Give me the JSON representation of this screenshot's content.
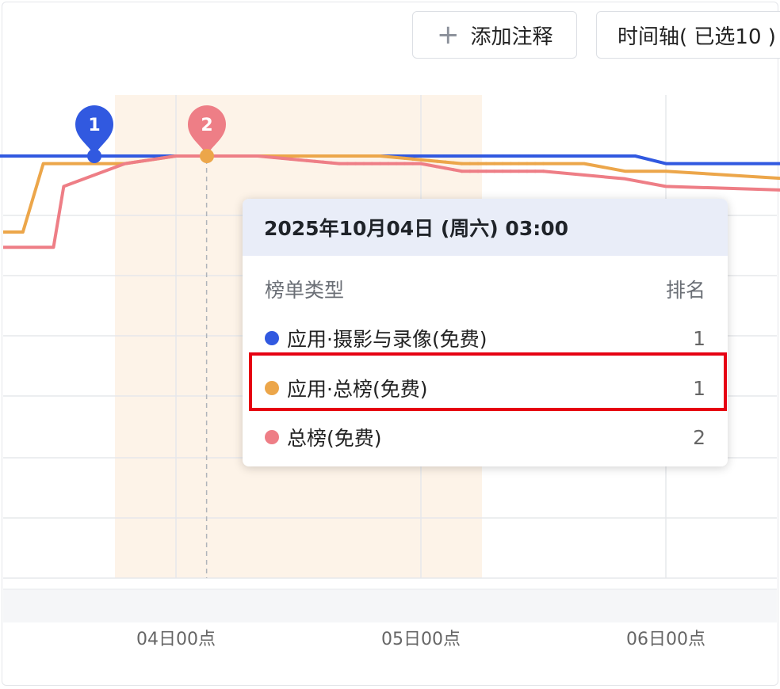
{
  "toolbar": {
    "add_note_label": "添加注释",
    "timeline_label": "时间轴( 已选10 )"
  },
  "markers": [
    {
      "label": "1",
      "color": "#3159e0"
    },
    {
      "label": "2",
      "color": "#ee7e86"
    }
  ],
  "tooltip": {
    "title": "2025年10月04日 (周六) 03:00",
    "col_type": "榜单类型",
    "col_rank": "排名",
    "rows": [
      {
        "name": "应用·摄影与录像(免费)",
        "rank": "1",
        "color": "#3159e0"
      },
      {
        "name": "应用·总榜(免费)",
        "rank": "1",
        "color": "#eca64a"
      },
      {
        "name": "总榜(免费)",
        "rank": "2",
        "color": "#ee7e86"
      }
    ]
  },
  "chart_data": {
    "type": "line",
    "x_ticks": [
      "04日00点",
      "05日00点",
      "06日00点"
    ],
    "y_axis": {
      "inverted": true,
      "min_rank": 1,
      "max_rank": 4
    },
    "grid": true,
    "highlight_band": {
      "start": "10月03日 21:00",
      "end": "10月05日 02:00",
      "color": "#fdf3e8"
    },
    "series": [
      {
        "name": "应用·摄影与录像(免费)",
        "color": "#3159e0",
        "values": [
          [
            -20,
            1.0
          ],
          [
            -18,
            1.0
          ],
          [
            -5,
            1.0
          ],
          [
            0,
            1.0
          ],
          [
            10,
            1.0
          ],
          [
            20,
            1.0
          ],
          [
            30,
            1.0
          ],
          [
            40,
            1.0
          ],
          [
            45,
            1.0
          ],
          [
            48,
            1.1
          ],
          [
            60,
            1.1
          ],
          [
            72,
            1.1
          ]
        ]
      },
      {
        "name": "应用·总榜(免费)",
        "color": "#eca64a",
        "values": [
          [
            -20,
            2.0
          ],
          [
            -15,
            2.0
          ],
          [
            -13,
            1.1
          ],
          [
            -5,
            1.1
          ],
          [
            0,
            1.0
          ],
          [
            20,
            1.0
          ],
          [
            28,
            1.1
          ],
          [
            40,
            1.1
          ],
          [
            44,
            1.2
          ],
          [
            48,
            1.2
          ],
          [
            60,
            1.3
          ],
          [
            72,
            1.3
          ]
        ]
      },
      {
        "name": "总榜(免费)",
        "color": "#ee7e86",
        "values": [
          [
            -18,
            2.2
          ],
          [
            -12,
            2.2
          ],
          [
            -11,
            1.4
          ],
          [
            -5,
            1.1
          ],
          [
            0,
            1.0
          ],
          [
            8,
            1.0
          ],
          [
            16,
            1.1
          ],
          [
            24,
            1.1
          ],
          [
            28,
            1.2
          ],
          [
            36,
            1.2
          ],
          [
            44,
            1.3
          ],
          [
            48,
            1.4
          ],
          [
            72,
            1.5
          ]
        ]
      }
    ]
  }
}
